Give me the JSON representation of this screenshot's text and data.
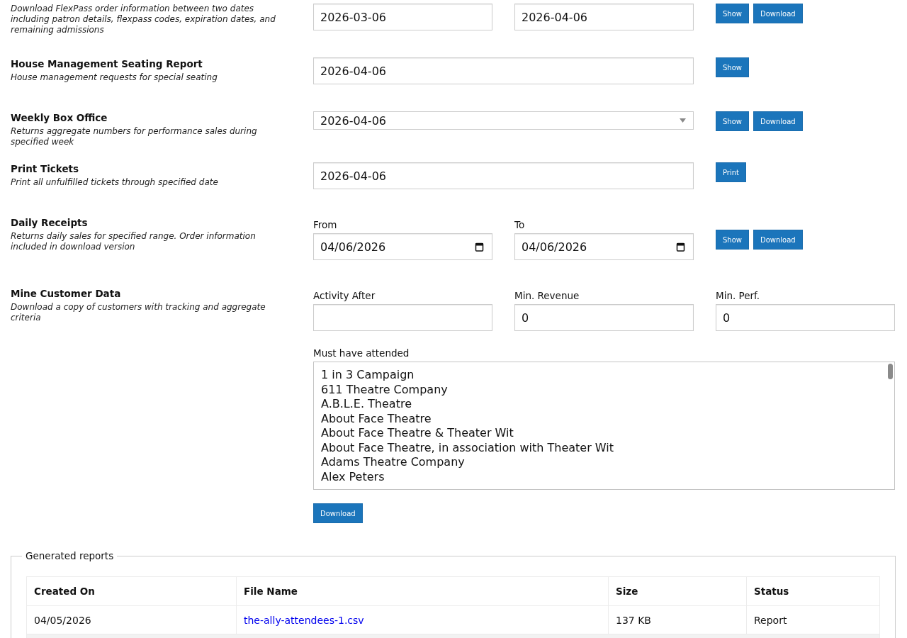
{
  "reports": [
    {
      "description": "Download FlexPass order information between two dates including patron details, flexpass codes, expiration dates, and remaining admissions",
      "fields": [
        {
          "kind": "text",
          "value": "2026-03-06"
        },
        {
          "kind": "text",
          "value": "2026-04-06"
        }
      ],
      "buttons": [
        "Show",
        "Download"
      ]
    },
    {
      "title": "House Management Seating Report",
      "description": "House management requests for special seating",
      "fields": [
        {
          "kind": "text",
          "value": "2026-04-06"
        }
      ],
      "buttons": [
        "Show"
      ]
    },
    {
      "title": "Weekly Box Office",
      "description": "Returns aggregate numbers for performance sales during specified week",
      "fields": [
        {
          "kind": "select",
          "value": "2026-04-06"
        }
      ],
      "buttons": [
        "Show",
        "Download"
      ]
    },
    {
      "title": "Print Tickets",
      "description": "Print all unfulfilled tickets through specified date",
      "fields": [
        {
          "kind": "text",
          "value": "2026-04-06"
        }
      ],
      "buttons": [
        "Print"
      ]
    },
    {
      "title": "Daily Receipts",
      "description": "Returns daily sales for specified range. Order information included in download version",
      "fields": [
        {
          "kind": "date",
          "label": "From",
          "value": "04/06/2026"
        },
        {
          "kind": "date",
          "label": "To",
          "value": "04/06/2026"
        }
      ],
      "buttons": [
        "Show",
        "Download"
      ]
    },
    {
      "title": "Mine Customer Data",
      "description": "Download a copy of customers with tracking and aggregate criteria",
      "fields": [
        {
          "kind": "text",
          "label": "Activity After"
        },
        {
          "kind": "text",
          "label": "Min. Revenue",
          "value": "0"
        },
        {
          "kind": "text",
          "label": "Min. Perf.",
          "value": "0"
        },
        {
          "kind": "listbox",
          "label": "Must have attended",
          "options": [
            {
              "label": "1 in 3 Campaign",
              "selected": false
            },
            {
              "label": "611 Theatre Company",
              "selected": false
            },
            {
              "label": "A.B.L.E. Theatre",
              "selected": false
            },
            {
              "label": "About Face Theatre",
              "selected": false
            },
            {
              "label": "About Face Theatre & Theater Wit",
              "selected": false
            },
            {
              "label": "About Face Theatre, in association with Theater Wit",
              "selected": false
            },
            {
              "label": "Adams Theatre Company",
              "selected": false
            },
            {
              "label": "Alex Peters",
              "selected": false
            }
          ]
        }
      ],
      "buttons": [
        "Download"
      ]
    }
  ],
  "generated_reports": {
    "legend": "Generated reports",
    "columns": [
      {
        "label": "Created On",
        "kind": "text"
      },
      {
        "label": "File Name",
        "kind": "link"
      },
      {
        "label": "Size",
        "kind": "text"
      },
      {
        "label": "Status",
        "kind": "text"
      }
    ],
    "rows": [
      {
        "cells": [
          "04/05/2026",
          "the-ally-attendees-1.csv",
          "137 KB",
          "Report"
        ]
      }
    ]
  }
}
